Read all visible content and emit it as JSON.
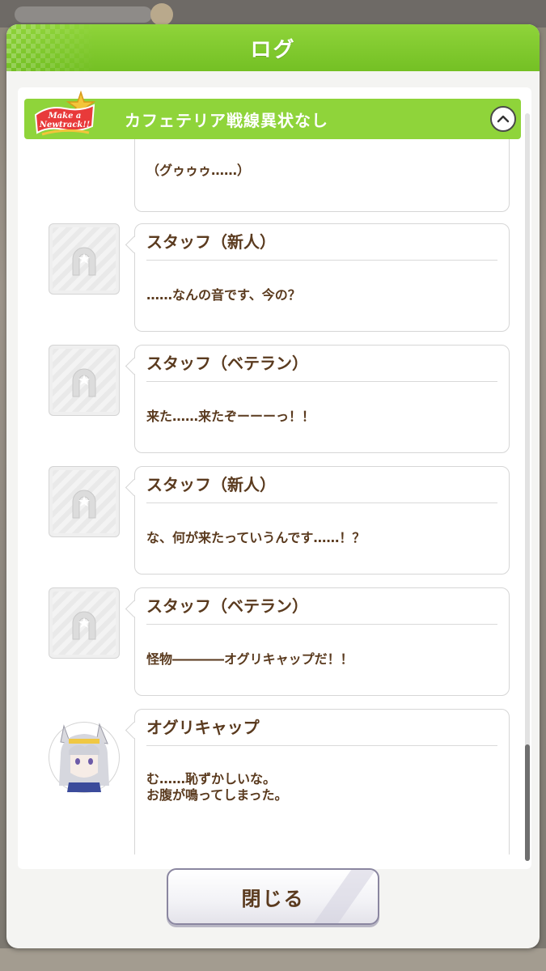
{
  "window": {
    "title": "ログ"
  },
  "story": {
    "title": "カフェテリア戦線異状なし",
    "logo_text": "Make a\nNewtrack!!"
  },
  "entries": [
    {
      "speaker": "",
      "text": "（グゥゥゥ……）"
    },
    {
      "speaker": "スタッフ（新人）",
      "text": "……なんの音です、今の？"
    },
    {
      "speaker": "スタッフ（ベテラン）",
      "text": "来た……来たぞーーーっ！！"
    },
    {
      "speaker": "スタッフ（新人）",
      "text": "な、何が来たっていうんです……！？"
    },
    {
      "speaker": "スタッフ（ベテラン）",
      "text": "怪物――――オグリキャップだ！！"
    },
    {
      "speaker": "オグリキャップ",
      "text": "む……恥ずかしいな。\nお腹が鳴ってしまった。"
    }
  ],
  "buttons": {
    "close_label": "閉じる"
  },
  "colors": {
    "header_green": "#7cc82c",
    "text_brown": "#5a3a1e",
    "panel_bg": "#f4f4f2"
  },
  "icons": {
    "collapse": "chevron-up-icon",
    "placeholder_avatar": "horseshoe-icon"
  }
}
